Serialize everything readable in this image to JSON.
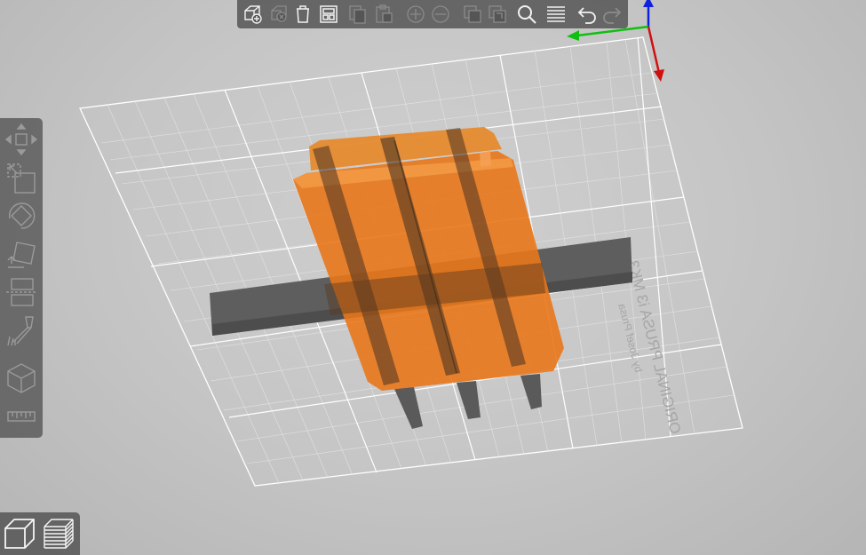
{
  "bed": {
    "label_line1": "ORIGINAL PRUSA i3 MK3",
    "label_line2": "by Josef Prusa"
  },
  "colors": {
    "background": "#c4c4c4",
    "object": "#e8771a",
    "support": "#5a5a5a",
    "grid": "#ffffff",
    "axis_x": "#d01010",
    "axis_y": "#10c010",
    "axis_z": "#1020e0",
    "toolbar": "#555555"
  },
  "top_toolbar": {
    "items": [
      {
        "name": "add-icon",
        "enabled": true
      },
      {
        "name": "delete-icon",
        "enabled": false
      },
      {
        "name": "delete-all-icon",
        "enabled": true
      },
      {
        "name": "arrange-icon",
        "enabled": true
      },
      {
        "name": "copy-icon",
        "enabled": false
      },
      {
        "name": "paste-icon",
        "enabled": false
      },
      {
        "name": "add-instance-icon",
        "enabled": false
      },
      {
        "name": "remove-instance-icon",
        "enabled": false
      },
      {
        "name": "split-to-objects-icon",
        "enabled": false
      },
      {
        "name": "split-to-parts-icon",
        "enabled": false
      },
      {
        "name": "search-icon",
        "enabled": true
      },
      {
        "name": "layers-editing-icon",
        "enabled": true
      },
      {
        "name": "undo-icon",
        "enabled": true
      },
      {
        "name": "redo-icon",
        "enabled": false
      }
    ]
  },
  "left_toolbar": {
    "items": [
      "move-icon",
      "scale-icon",
      "rotate-icon",
      "place-on-face-icon",
      "cut-icon",
      "paint-supports-icon",
      "hollow-icon",
      "measure-icon"
    ]
  },
  "view_switch": {
    "items": [
      "3d-view-icon",
      "preview-layers-icon"
    ]
  }
}
